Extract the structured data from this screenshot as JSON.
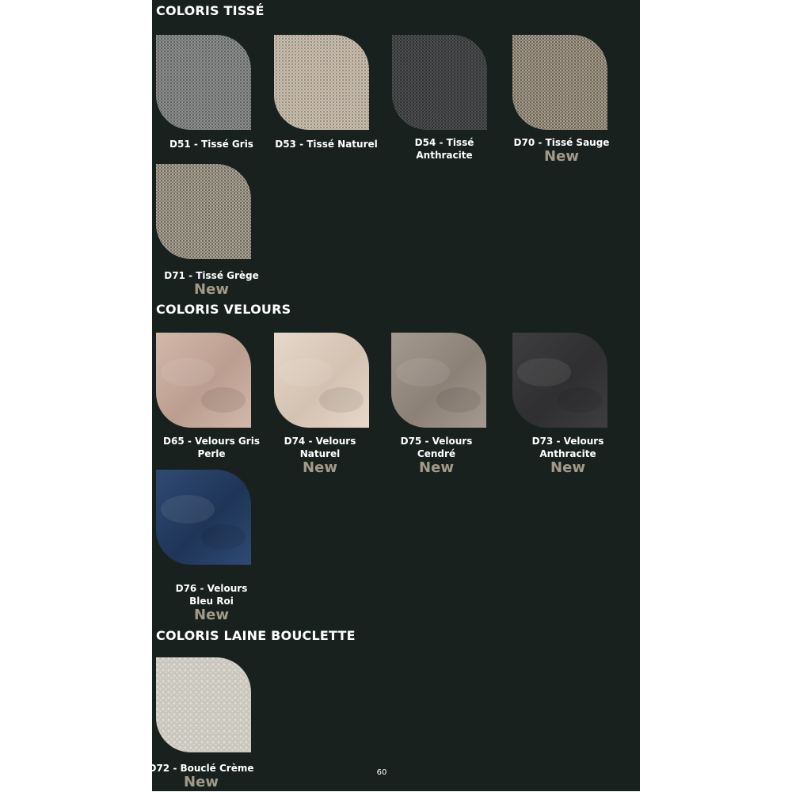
{
  "page": {
    "background": "#19211f",
    "new_color": "#a39a88",
    "page_number": "60"
  },
  "sections": {
    "tisse": {
      "title": "COLORIS TISSÉ",
      "items": [
        {
          "label": "D51 - Tissé Gris",
          "new": "",
          "texture": "woven",
          "color": "#7d807f",
          "highlight": "#a9acab"
        },
        {
          "label": "D53 - Tissé Naturel",
          "new": "",
          "texture": "woven",
          "color": "#c9bcaa",
          "highlight": "#e6dccd"
        },
        {
          "label": "D54 - Tissé Anthracite",
          "new": "",
          "texture": "woven",
          "color": "#3f4142",
          "highlight": "#5f6263"
        },
        {
          "label": "D70 - Tissé Sauge",
          "new": "New",
          "texture": "woven",
          "color": "#8b8170",
          "highlight": "#c9c0b0"
        },
        {
          "label": "D71 - Tissé Grège",
          "new": "New",
          "texture": "woven",
          "color": "#8f8779",
          "highlight": "#d1cabc"
        }
      ]
    },
    "velours": {
      "title": "COLORIS VELOURS",
      "items": [
        {
          "label": "D65 - Velours Gris\nPerle",
          "new": "",
          "texture": "velvet",
          "color": "#bb9e90",
          "highlight": "#d3b8aa"
        },
        {
          "label": "D74 - Velours\nNaturel",
          "new": "New",
          "texture": "velvet",
          "color": "#d4c2b1",
          "highlight": "#e6d8ca"
        },
        {
          "label": "D75 - Velours\nCendré",
          "new": "New",
          "texture": "velvet",
          "color": "#8c8177",
          "highlight": "#a59a8f"
        },
        {
          "label": "D73 - Velours\nAnthracite",
          "new": "New",
          "texture": "velvet",
          "color": "#2f2f31",
          "highlight": "#3e3e40"
        },
        {
          "label": "D76 - Velours\nBleu Roi",
          "new": "New",
          "texture": "velvet",
          "color": "#1f3558",
          "highlight": "#2f4a73"
        }
      ]
    },
    "bouclette": {
      "title": "COLORIS LAINE BOUCLETTE",
      "items": [
        {
          "label": "D72 - Bouclé Crème",
          "new": "New",
          "texture": "boucle",
          "color": "#c9c6be",
          "highlight": "#dedbd3"
        }
      ]
    }
  }
}
